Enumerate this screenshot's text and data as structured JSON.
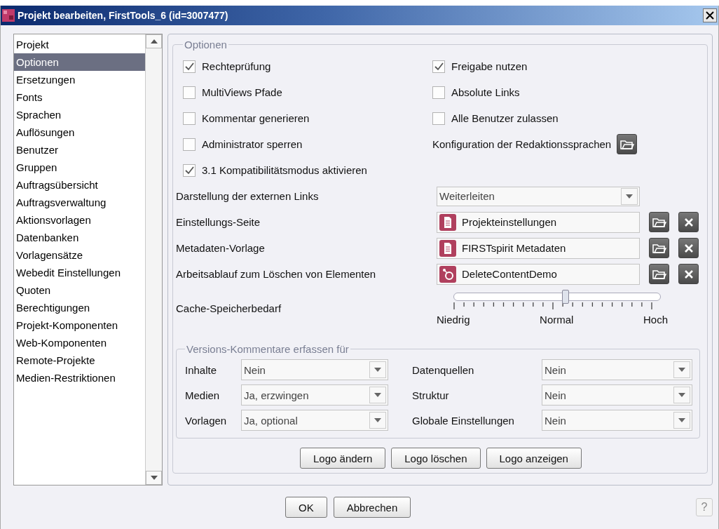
{
  "window": {
    "title": "Projekt bearbeiten, FirstTools_6 (id=3007477)"
  },
  "sidebar": {
    "items": [
      {
        "label": "Projekt",
        "selected": false
      },
      {
        "label": "Optionen",
        "selected": true
      },
      {
        "label": "Ersetzungen",
        "selected": false
      },
      {
        "label": "Fonts",
        "selected": false
      },
      {
        "label": "Sprachen",
        "selected": false
      },
      {
        "label": "Auflösungen",
        "selected": false
      },
      {
        "label": "Benutzer",
        "selected": false
      },
      {
        "label": "Gruppen",
        "selected": false
      },
      {
        "label": "Auftragsübersicht",
        "selected": false
      },
      {
        "label": "Auftragsverwaltung",
        "selected": false
      },
      {
        "label": "Aktionsvorlagen",
        "selected": false
      },
      {
        "label": "Datenbanken",
        "selected": false
      },
      {
        "label": "Vorlagensätze",
        "selected": false
      },
      {
        "label": "Webedit Einstellungen",
        "selected": false
      },
      {
        "label": "Quoten",
        "selected": false
      },
      {
        "label": "Berechtigungen",
        "selected": false
      },
      {
        "label": "Projekt-Komponenten",
        "selected": false
      },
      {
        "label": "Web-Komponenten",
        "selected": false
      },
      {
        "label": "Remote-Projekte",
        "selected": false
      },
      {
        "label": "Medien-Restriktionen",
        "selected": false
      }
    ]
  },
  "options": {
    "legend": "Optionen",
    "left_checks": [
      {
        "label": "Rechteprüfung",
        "checked": true
      },
      {
        "label": "MultiViews Pfade",
        "checked": false
      },
      {
        "label": "Kommentar generieren",
        "checked": false
      },
      {
        "label": "Administrator sperren",
        "checked": false
      },
      {
        "label": "3.1 Kompatibilitätsmodus aktivieren",
        "checked": true
      }
    ],
    "right_checks": [
      {
        "label": "Freigabe nutzen",
        "checked": true
      },
      {
        "label": "Absolute Links",
        "checked": false
      },
      {
        "label": "Alle Benutzer zulassen",
        "checked": false
      }
    ],
    "config_label": "Konfiguration der Redaktionssprachen",
    "fields": [
      {
        "label": "Darstellung der externen Links",
        "kind": "select",
        "value": "Weiterleiten"
      },
      {
        "label": "Einstellungs-Seite",
        "kind": "page",
        "value": "Projekteinstellungen"
      },
      {
        "label": "Metadaten-Vorlage",
        "kind": "page",
        "value": "FIRSTspirit Metadaten"
      },
      {
        "label": "Arbeitsablauf zum Löschen von Elementen",
        "kind": "workflow",
        "value": "DeleteContentDemo"
      }
    ],
    "cache": {
      "label": "Cache-Speicherbedarf",
      "level": 0.54,
      "ticks": [
        "Niedrig",
        "Normal",
        "Hoch"
      ]
    },
    "versions": {
      "legend": "Versions-Kommentare erfassen für",
      "rows": [
        {
          "label": "Inhalte",
          "value": "Nein"
        },
        {
          "label": "Datenquellen",
          "value": "Nein"
        },
        {
          "label": "Medien",
          "value": "Ja, erzwingen"
        },
        {
          "label": "Struktur",
          "value": "Nein"
        },
        {
          "label": "Vorlagen",
          "value": "Ja, optional"
        },
        {
          "label": "Globale Einstellungen",
          "value": "Nein"
        }
      ]
    },
    "logo_buttons": [
      "Logo ändern",
      "Logo löschen",
      "Logo anzeigen"
    ]
  },
  "buttons": [
    "OK",
    "Abbrechen"
  ],
  "help": "?"
}
